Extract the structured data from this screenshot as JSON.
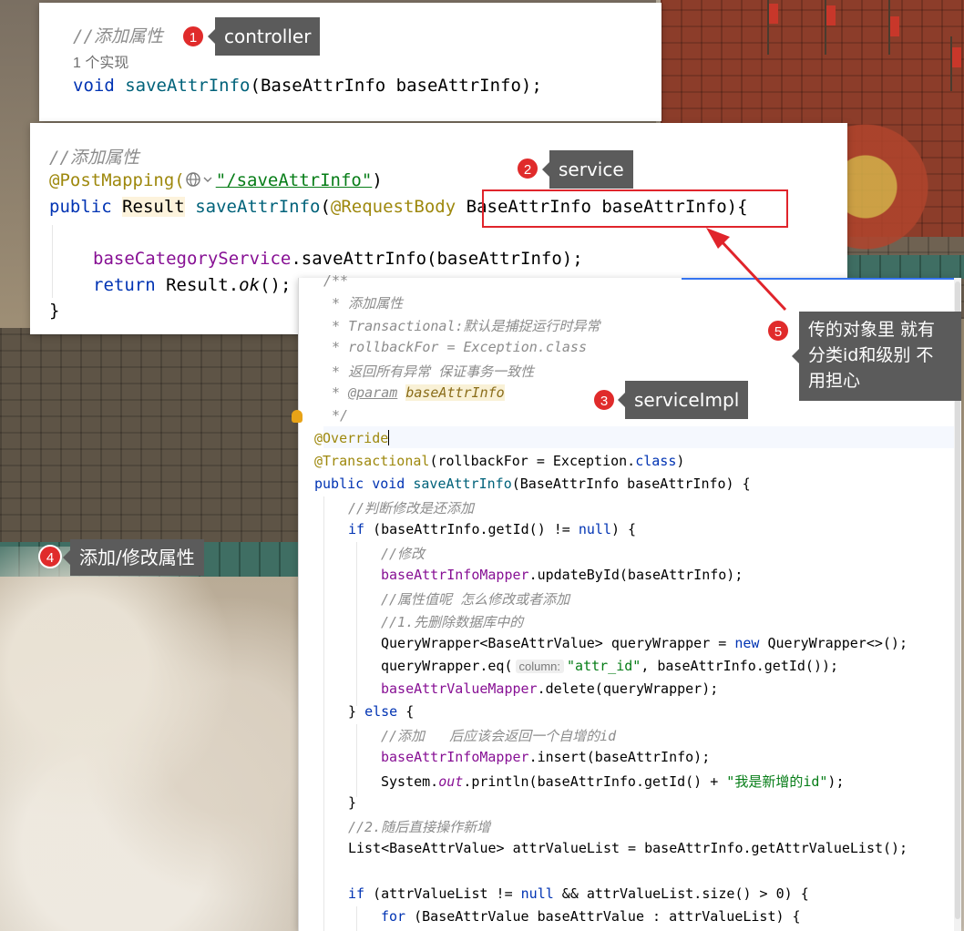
{
  "window1": {
    "comment": "//添加属性",
    "impl_count": "1 个实现",
    "signature": {
      "kw": "void",
      "name": "saveAttrInfo",
      "params": "(BaseAttrInfo baseAttrInfo);"
    }
  },
  "window2": {
    "comment": "//添加属性",
    "mapping_ann": "@PostMapping(",
    "mapping_path": "\"/saveAttrInfo\"",
    "mapping_close": ")",
    "sig_public": "public",
    "sig_result": "Result",
    "sig_name": "saveAttrInfo",
    "sig_open": "(",
    "sig_ann": "@RequestBody",
    "sig_param": "BaseAttrInfo baseAttrInfo){",
    "call_obj": "baseCategoryService",
    "call_rest": ".saveAttrInfo(baseAttrInfo);",
    "return_kw": "return",
    "return_obj": "Result.",
    "return_method": "ok",
    "return_end": "();",
    "close_brace": "}"
  },
  "window3": {
    "doc": [
      "/**",
      " * 添加属性",
      " * Transactional:默认是捕捉运行时异常",
      " * rollbackFor = Exception.class",
      " * 返回所有异常 保证事务一致性",
      " * ",
      " */"
    ],
    "doc_param_tag": "@param",
    "doc_param_name": "baseAttrInfo",
    "override": "@Override",
    "transactional_ann": "@Transactional",
    "transactional_rest1": "(rollbackFor = Exception.",
    "transactional_class": "class",
    "transactional_rest2": ")",
    "sig": {
      "kw1": "public",
      "kw2": "void",
      "name": "saveAttrInfo",
      "rest": "(BaseAttrInfo baseAttrInfo) {"
    },
    "c_judge": "//判断修改是还添加",
    "if_kw": "if",
    "if_cond": " (baseAttrInfo.getId() != ",
    "null_kw": "null",
    "if_end": ") {",
    "c_modify": "//修改",
    "mapper1": "baseAttrInfoMapper",
    "update_rest": ".updateById(baseAttrInfo);",
    "c_values": "//属性值呢 怎么修改或者添加",
    "c_step1": "//1.先删除数据库中的",
    "qw_decl": "QueryWrapper<BaseAttrValue> queryWrapper = ",
    "new_kw": "new",
    "qw_new": " QueryWrapper<>();",
    "qw_eq": "queryWrapper.eq(",
    "qw_hint": "column:",
    "qw_col": "\"attr_id\"",
    "qw_eq_rest": ", baseAttrInfo.getId());",
    "mapper2": "baseAttrValueMapper",
    "delete_rest": ".delete(queryWrapper);",
    "else_open": "} ",
    "else_kw": "else",
    "else_close": " {",
    "c_add": "//添加   后应该会返回一个自增的id",
    "insert_rest": ".insert(baseAttrInfo);",
    "sys_pre": "System.",
    "sys_out": "out",
    "sys_mid": ".println(baseAttrInfo.getId() + ",
    "sys_str": "\"我是新增的id\"",
    "sys_end": ");",
    "brace_close": "}",
    "c_step2": "//2.随后直接操作新增",
    "list_decl": "List<BaseAttrValue> attrValueList = baseAttrInfo.getAttrValueList();",
    "if2_kw": "if",
    "if2_a": " (attrValueList != ",
    "if2_null": "null",
    "if2_b": " && attrValueList.size() > 0) {",
    "for_kw": "for",
    "for_rest": " (BaseAttrValue baseAttrValue : attrValueList) {"
  },
  "annotations": [
    {
      "num": "1",
      "label": "controller"
    },
    {
      "num": "2",
      "label": "service"
    },
    {
      "num": "3",
      "label": "serviceImpl"
    },
    {
      "num": "4",
      "label": "添加/修改属性"
    },
    {
      "num": "5",
      "label": "传的对象里 就有\n分类id和级别 不\n用担心"
    }
  ],
  "colors": {
    "badge": "#e02b2b",
    "tag_bg": "#5b5b5b",
    "red_box": "#e0242b",
    "keyword": "#0033b3",
    "function": "#00627a",
    "annotation": "#9e880d",
    "string": "#067d17",
    "field": "#871094",
    "comment": "#8c8c8c"
  }
}
